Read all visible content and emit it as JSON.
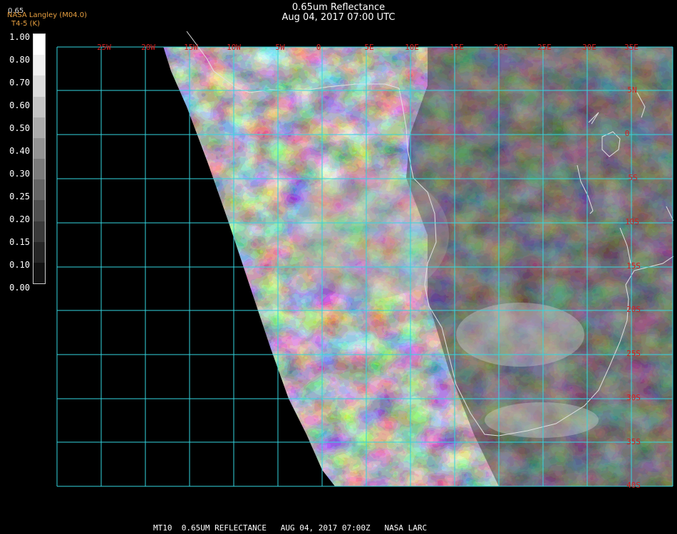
{
  "header": {
    "title": "0.65um Reflectance",
    "datetime": "Aug 04, 2017 07:00 UTC",
    "source": "NASA Langley (M04.0)",
    "source_sub": "T4-5 (K)",
    "band": "0.65"
  },
  "colorbar": {
    "labels": [
      "1.00",
      "0.80",
      "0.70",
      "0.60",
      "0.50",
      "0.40",
      "0.30",
      "0.25",
      "0.20",
      "0.15",
      "0.10",
      "0.00"
    ],
    "segment_colors": [
      "#ffffff",
      "#f0f0f0",
      "#dcdcdc",
      "#c4c4c4",
      "#ababab",
      "#939393",
      "#7b7b7b",
      "#656565",
      "#4f4f4f",
      "#3a3a3a",
      "#262626",
      "#121212"
    ]
  },
  "map": {
    "grid_color": "#33d6e0",
    "label_color": "#d21e1e",
    "coast_color": "#e0e0e0",
    "lon_labels": [
      "25W",
      "20W",
      "15W",
      "10W",
      "5W",
      "0",
      "5E",
      "10E",
      "15E",
      "20E",
      "25E",
      "30E",
      "35E"
    ],
    "lat_labels": [
      "5N",
      "0",
      "5S",
      "10S",
      "15S",
      "20S",
      "25S",
      "30S",
      "35S",
      "40S"
    ]
  },
  "footer": {
    "text": "MT10  0.65UM REFLECTANCE   AUG 04, 2017 07:00Z   NASA LARC"
  }
}
